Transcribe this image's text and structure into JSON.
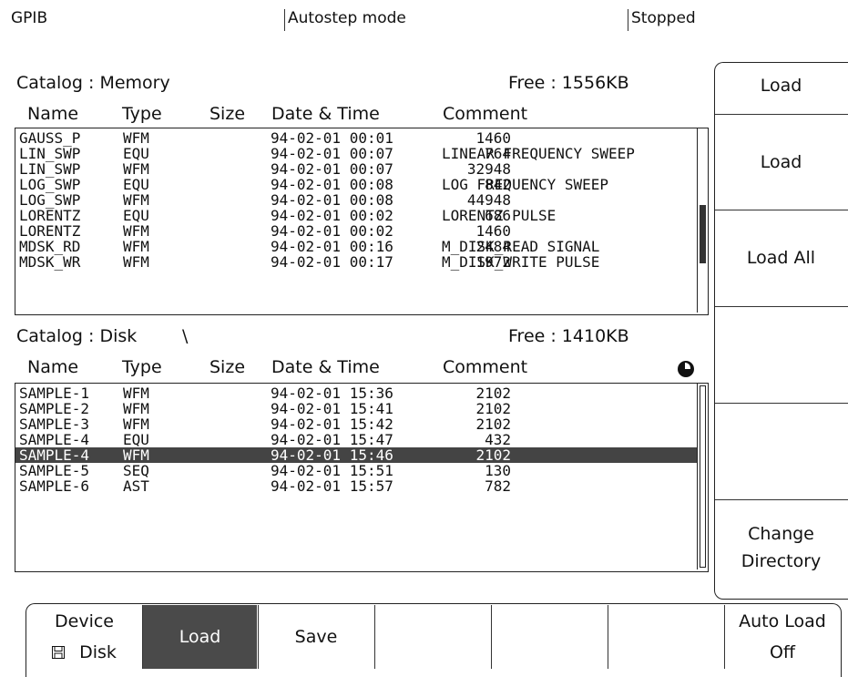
{
  "status": {
    "interface": "GPIB",
    "mode": "Autostep mode",
    "state": "Stopped"
  },
  "memory": {
    "title": "Catalog : Memory",
    "free": "Free : 1556KB",
    "headers": {
      "name": "Name",
      "type": "Type",
      "size": "Size",
      "datetime": "Date & Time",
      "comment": "Comment"
    },
    "rows": [
      {
        "name": "GAUSS_P",
        "type": "WFM",
        "size": "1460",
        "date": "94-02-01 00:01",
        "comment": ""
      },
      {
        "name": "LIN_SWP",
        "type": "EQU",
        "size": "764",
        "date": "94-02-01 00:07",
        "comment": "LINEAR FREQUENCY SWEEP"
      },
      {
        "name": "LIN_SWP",
        "type": "WFM",
        "size": "32948",
        "date": "94-02-01 00:07",
        "comment": ""
      },
      {
        "name": "LOG_SWP",
        "type": "EQU",
        "size": "842",
        "date": "94-02-01 00:08",
        "comment": "LOG FREQUENCY SWEEP"
      },
      {
        "name": "LOG_SWP",
        "type": "WFM",
        "size": "44948",
        "date": "94-02-01 00:08",
        "comment": ""
      },
      {
        "name": "LORENTZ",
        "type": "EQU",
        "size": "686",
        "date": "94-02-01 00:02",
        "comment": "LORENTZ PULSE"
      },
      {
        "name": "LORENTZ",
        "type": "WFM",
        "size": "1460",
        "date": "94-02-01 00:02",
        "comment": ""
      },
      {
        "name": "MDSK_RD",
        "type": "WFM",
        "size": "2484",
        "date": "94-02-01 00:16",
        "comment": "M_DISK_READ SIGNAL"
      },
      {
        "name": "MDSK_WR",
        "type": "WFM",
        "size": "1972",
        "date": "94-02-01 00:17",
        "comment": "M_DISK_WRITE PULSE"
      }
    ]
  },
  "disk": {
    "title": "Catalog : Disk",
    "path": "\\",
    "free": "Free : 1410KB",
    "headers": {
      "name": "Name",
      "type": "Type",
      "size": "Size",
      "datetime": "Date & Time",
      "comment": "Comment"
    },
    "rows": [
      {
        "name": "SAMPLE-1",
        "type": "WFM",
        "size": "2102",
        "date": "94-02-01 15:36",
        "comment": "",
        "selected": false
      },
      {
        "name": "SAMPLE-2",
        "type": "WFM",
        "size": "2102",
        "date": "94-02-01 15:41",
        "comment": "",
        "selected": false
      },
      {
        "name": "SAMPLE-3",
        "type": "WFM",
        "size": "2102",
        "date": "94-02-01 15:42",
        "comment": "",
        "selected": false
      },
      {
        "name": "SAMPLE-4",
        "type": "EQU",
        "size": "432",
        "date": "94-02-01 15:47",
        "comment": "",
        "selected": false
      },
      {
        "name": "SAMPLE-4",
        "type": "WFM",
        "size": "2102",
        "date": "94-02-01 15:46",
        "comment": "",
        "selected": true
      },
      {
        "name": "SAMPLE-5",
        "type": "SEQ",
        "size": "130",
        "date": "94-02-01 15:51",
        "comment": "",
        "selected": false
      },
      {
        "name": "SAMPLE-6",
        "type": "AST",
        "size": "782",
        "date": "94-02-01 15:57",
        "comment": "",
        "selected": false
      }
    ]
  },
  "side_menu": {
    "load_title": "Load",
    "load": "Load",
    "load_all": "Load All",
    "change_dir_1": "Change",
    "change_dir_2": "Directory"
  },
  "bottom_menu": {
    "device_label": "Device",
    "device_value": "Disk",
    "load": "Load",
    "save": "Save",
    "auto_load_label": "Auto Load",
    "auto_load_value": "Off"
  },
  "icons": {
    "disk_activity": "disk-activity-icon",
    "floppy": "floppy-icon"
  }
}
